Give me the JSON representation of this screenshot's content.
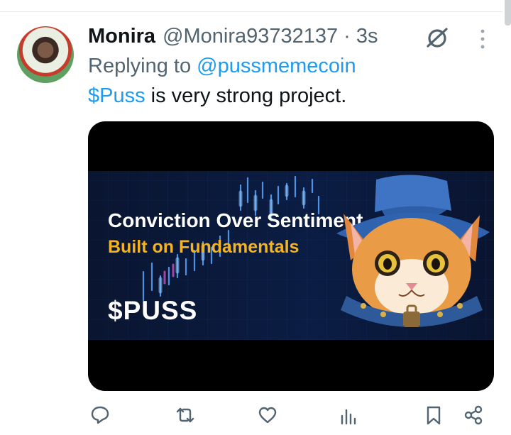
{
  "tweet": {
    "author_name": "Monira",
    "handle": "@Monira93732137",
    "separator": "·",
    "time": "3s",
    "replying_to_label": "Replying to",
    "replying_to_handle": "@pussmemecoin",
    "cashtag": "$Puss",
    "body_text": " is very strong project."
  },
  "media": {
    "headline_line1": "Conviction Over Sentiment",
    "headline_line2": "Built on Fundamentals",
    "ticker": "$PUSS"
  },
  "actions": {
    "reply_icon": "reply-icon",
    "retweet_icon": "retweet-icon",
    "like_icon": "heart-icon",
    "views_icon": "views-icon",
    "bookmark_icon": "bookmark-icon",
    "share_icon": "share-icon"
  },
  "colors": {
    "accent": "#1d9bf0",
    "secondary_text": "#536471",
    "primary_text": "#0f1419",
    "media_headline_gold": "#f4b323"
  }
}
